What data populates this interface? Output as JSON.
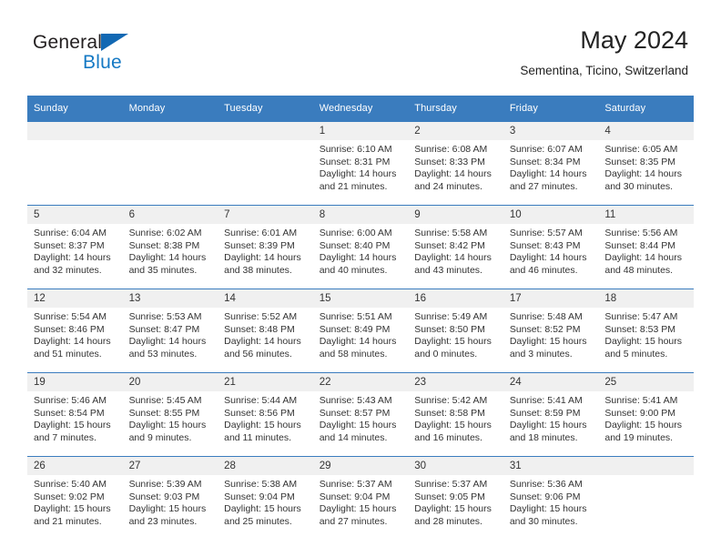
{
  "brand": {
    "word_one": "General",
    "word_two": "Blue",
    "triangle_color": "#1268b3",
    "blue_color": "#1579c4"
  },
  "header": {
    "title": "May 2024",
    "subtitle": "Sementina, Ticino, Switzerland"
  },
  "theme": {
    "header_band": "#3a7cbe",
    "daynum_band": "#f0f0f0",
    "text": "#333333"
  },
  "weekday_headers": [
    "Sunday",
    "Monday",
    "Tuesday",
    "Wednesday",
    "Thursday",
    "Friday",
    "Saturday"
  ],
  "labels": {
    "sunrise_prefix": "Sunrise:",
    "sunset_prefix": "Sunset:",
    "daylight_prefix": "Daylight:"
  },
  "weeks": [
    [
      {
        "day": "",
        "blank": true
      },
      {
        "day": "",
        "blank": true
      },
      {
        "day": "",
        "blank": true
      },
      {
        "day": "1",
        "sunrise": "Sunrise: 6:10 AM",
        "sunset": "Sunset: 8:31 PM",
        "daylight_1": "Daylight: 14 hours",
        "daylight_2": "and 21 minutes."
      },
      {
        "day": "2",
        "sunrise": "Sunrise: 6:08 AM",
        "sunset": "Sunset: 8:33 PM",
        "daylight_1": "Daylight: 14 hours",
        "daylight_2": "and 24 minutes."
      },
      {
        "day": "3",
        "sunrise": "Sunrise: 6:07 AM",
        "sunset": "Sunset: 8:34 PM",
        "daylight_1": "Daylight: 14 hours",
        "daylight_2": "and 27 minutes."
      },
      {
        "day": "4",
        "sunrise": "Sunrise: 6:05 AM",
        "sunset": "Sunset: 8:35 PM",
        "daylight_1": "Daylight: 14 hours",
        "daylight_2": "and 30 minutes."
      }
    ],
    [
      {
        "day": "5",
        "sunrise": "Sunrise: 6:04 AM",
        "sunset": "Sunset: 8:37 PM",
        "daylight_1": "Daylight: 14 hours",
        "daylight_2": "and 32 minutes."
      },
      {
        "day": "6",
        "sunrise": "Sunrise: 6:02 AM",
        "sunset": "Sunset: 8:38 PM",
        "daylight_1": "Daylight: 14 hours",
        "daylight_2": "and 35 minutes."
      },
      {
        "day": "7",
        "sunrise": "Sunrise: 6:01 AM",
        "sunset": "Sunset: 8:39 PM",
        "daylight_1": "Daylight: 14 hours",
        "daylight_2": "and 38 minutes."
      },
      {
        "day": "8",
        "sunrise": "Sunrise: 6:00 AM",
        "sunset": "Sunset: 8:40 PM",
        "daylight_1": "Daylight: 14 hours",
        "daylight_2": "and 40 minutes."
      },
      {
        "day": "9",
        "sunrise": "Sunrise: 5:58 AM",
        "sunset": "Sunset: 8:42 PM",
        "daylight_1": "Daylight: 14 hours",
        "daylight_2": "and 43 minutes."
      },
      {
        "day": "10",
        "sunrise": "Sunrise: 5:57 AM",
        "sunset": "Sunset: 8:43 PM",
        "daylight_1": "Daylight: 14 hours",
        "daylight_2": "and 46 minutes."
      },
      {
        "day": "11",
        "sunrise": "Sunrise: 5:56 AM",
        "sunset": "Sunset: 8:44 PM",
        "daylight_1": "Daylight: 14 hours",
        "daylight_2": "and 48 minutes."
      }
    ],
    [
      {
        "day": "12",
        "sunrise": "Sunrise: 5:54 AM",
        "sunset": "Sunset: 8:46 PM",
        "daylight_1": "Daylight: 14 hours",
        "daylight_2": "and 51 minutes."
      },
      {
        "day": "13",
        "sunrise": "Sunrise: 5:53 AM",
        "sunset": "Sunset: 8:47 PM",
        "daylight_1": "Daylight: 14 hours",
        "daylight_2": "and 53 minutes."
      },
      {
        "day": "14",
        "sunrise": "Sunrise: 5:52 AM",
        "sunset": "Sunset: 8:48 PM",
        "daylight_1": "Daylight: 14 hours",
        "daylight_2": "and 56 minutes."
      },
      {
        "day": "15",
        "sunrise": "Sunrise: 5:51 AM",
        "sunset": "Sunset: 8:49 PM",
        "daylight_1": "Daylight: 14 hours",
        "daylight_2": "and 58 minutes."
      },
      {
        "day": "16",
        "sunrise": "Sunrise: 5:49 AM",
        "sunset": "Sunset: 8:50 PM",
        "daylight_1": "Daylight: 15 hours",
        "daylight_2": "and 0 minutes."
      },
      {
        "day": "17",
        "sunrise": "Sunrise: 5:48 AM",
        "sunset": "Sunset: 8:52 PM",
        "daylight_1": "Daylight: 15 hours",
        "daylight_2": "and 3 minutes."
      },
      {
        "day": "18",
        "sunrise": "Sunrise: 5:47 AM",
        "sunset": "Sunset: 8:53 PM",
        "daylight_1": "Daylight: 15 hours",
        "daylight_2": "and 5 minutes."
      }
    ],
    [
      {
        "day": "19",
        "sunrise": "Sunrise: 5:46 AM",
        "sunset": "Sunset: 8:54 PM",
        "daylight_1": "Daylight: 15 hours",
        "daylight_2": "and 7 minutes."
      },
      {
        "day": "20",
        "sunrise": "Sunrise: 5:45 AM",
        "sunset": "Sunset: 8:55 PM",
        "daylight_1": "Daylight: 15 hours",
        "daylight_2": "and 9 minutes."
      },
      {
        "day": "21",
        "sunrise": "Sunrise: 5:44 AM",
        "sunset": "Sunset: 8:56 PM",
        "daylight_1": "Daylight: 15 hours",
        "daylight_2": "and 11 minutes."
      },
      {
        "day": "22",
        "sunrise": "Sunrise: 5:43 AM",
        "sunset": "Sunset: 8:57 PM",
        "daylight_1": "Daylight: 15 hours",
        "daylight_2": "and 14 minutes."
      },
      {
        "day": "23",
        "sunrise": "Sunrise: 5:42 AM",
        "sunset": "Sunset: 8:58 PM",
        "daylight_1": "Daylight: 15 hours",
        "daylight_2": "and 16 minutes."
      },
      {
        "day": "24",
        "sunrise": "Sunrise: 5:41 AM",
        "sunset": "Sunset: 8:59 PM",
        "daylight_1": "Daylight: 15 hours",
        "daylight_2": "and 18 minutes."
      },
      {
        "day": "25",
        "sunrise": "Sunrise: 5:41 AM",
        "sunset": "Sunset: 9:00 PM",
        "daylight_1": "Daylight: 15 hours",
        "daylight_2": "and 19 minutes."
      }
    ],
    [
      {
        "day": "26",
        "sunrise": "Sunrise: 5:40 AM",
        "sunset": "Sunset: 9:02 PM",
        "daylight_1": "Daylight: 15 hours",
        "daylight_2": "and 21 minutes."
      },
      {
        "day": "27",
        "sunrise": "Sunrise: 5:39 AM",
        "sunset": "Sunset: 9:03 PM",
        "daylight_1": "Daylight: 15 hours",
        "daylight_2": "and 23 minutes."
      },
      {
        "day": "28",
        "sunrise": "Sunrise: 5:38 AM",
        "sunset": "Sunset: 9:04 PM",
        "daylight_1": "Daylight: 15 hours",
        "daylight_2": "and 25 minutes."
      },
      {
        "day": "29",
        "sunrise": "Sunrise: 5:37 AM",
        "sunset": "Sunset: 9:04 PM",
        "daylight_1": "Daylight: 15 hours",
        "daylight_2": "and 27 minutes."
      },
      {
        "day": "30",
        "sunrise": "Sunrise: 5:37 AM",
        "sunset": "Sunset: 9:05 PM",
        "daylight_1": "Daylight: 15 hours",
        "daylight_2": "and 28 minutes."
      },
      {
        "day": "31",
        "sunrise": "Sunrise: 5:36 AM",
        "sunset": "Sunset: 9:06 PM",
        "daylight_1": "Daylight: 15 hours",
        "daylight_2": "and 30 minutes."
      },
      {
        "day": "",
        "blank": true
      }
    ]
  ]
}
